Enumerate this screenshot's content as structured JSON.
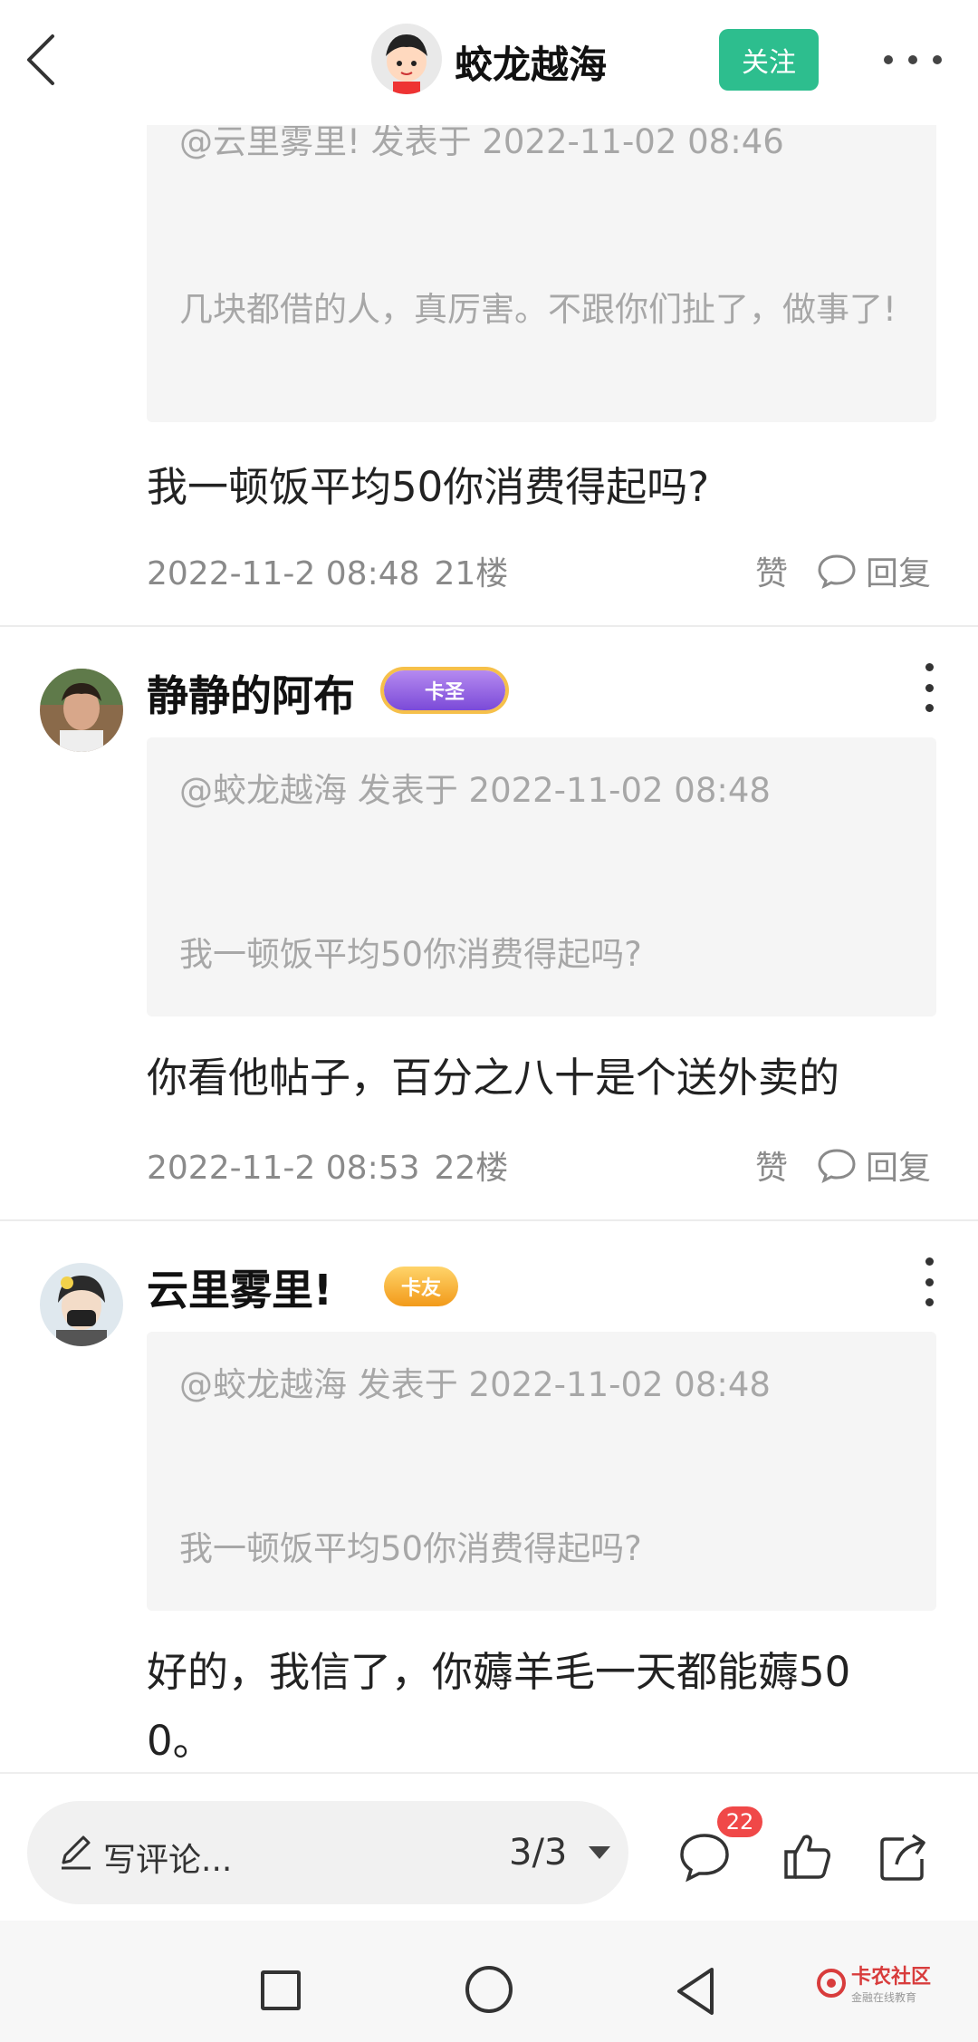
{
  "header": {
    "title": "蛟龙越海",
    "follow_label": "关注"
  },
  "posts": [
    {
      "quote_meta": "@云里雾里!   发表于 2022-11-02 08:46",
      "quote_text": "几块都借的人，真厉害。不跟你们扯了，做事了!",
      "content": "我一顿饭平均50你消费得起吗?",
      "time": "2022-11-2 08:48",
      "floor": "21楼",
      "like_label": "赞",
      "reply_label": "回复"
    },
    {
      "username": "静静的阿布",
      "badge": "卡圣",
      "quote_meta": "@蛟龙越海 发表于 2022-11-02 08:48",
      "quote_text": "我一顿饭平均50你消费得起吗?",
      "content": "你看他帖子，百分之八十是个送外卖的",
      "time": "2022-11-2 08:53",
      "floor": "22楼",
      "like_label": "赞",
      "reply_label": "回复"
    },
    {
      "username": "云里雾里!",
      "badge": "卡友",
      "quote_meta": "@蛟龙越海 发表于 2022-11-02 08:48",
      "quote_text": "我一顿饭平均50你消费得起吗?",
      "content_line1": "好的，我信了，你薅羊毛一天都能薅50",
      "content_line2": "0。"
    }
  ],
  "bottom_bar": {
    "comment_placeholder": "写评论...",
    "page_indicator": "3/3",
    "comment_count": "22"
  },
  "watermark": {
    "main": "卡农社区",
    "sub": "金融在线教育"
  },
  "colors": {
    "accent": "#2dbe8e",
    "badge_red": "#f04848",
    "quote_bg": "#f5f5f5"
  }
}
